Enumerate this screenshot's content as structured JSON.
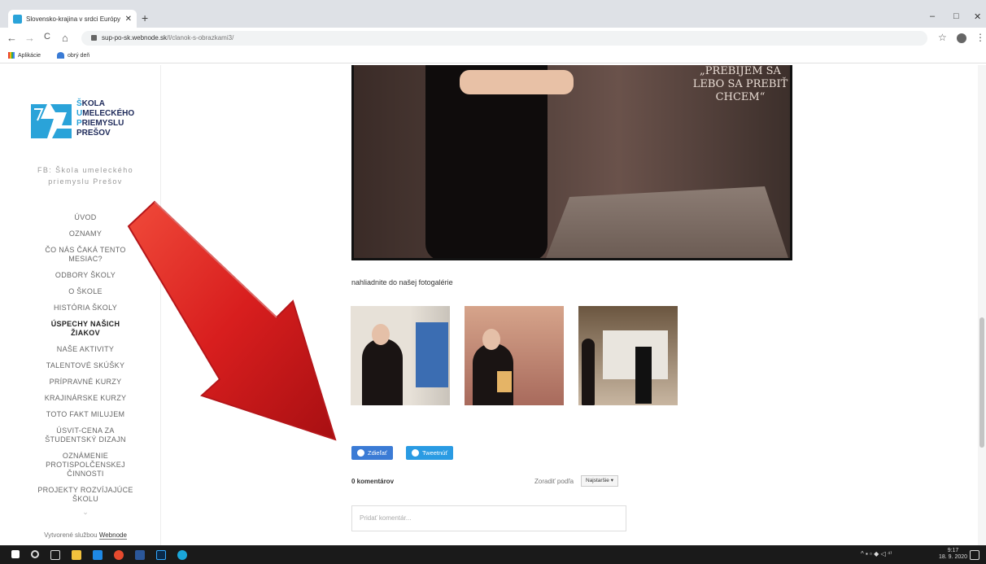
{
  "browser": {
    "tab_title": "Slovensko-krajina v srdci Európy",
    "tab_close": "✕",
    "new_tab": "+",
    "url_host": "sup-po-sk.webnode.sk",
    "url_path": "/l/clanok-s-obrazkami3/",
    "nav_back": "←",
    "nav_forward": "→",
    "nav_reload": "C",
    "nav_home": "⌂",
    "star": "☆",
    "menu": "⋮",
    "win_min": "–",
    "win_max": "□",
    "win_close": "✕",
    "bookmarks": [
      "Aplikácie",
      "obrý deň"
    ]
  },
  "site": {
    "logo_lines": [
      {
        "cap": "Š",
        "rest": "KOLA"
      },
      {
        "cap": "U",
        "rest": "MELECKÉHO"
      },
      {
        "cap": "P",
        "rest": "RIEMYSLU"
      },
      {
        "cap": "",
        "rest": "PREŠOV"
      }
    ],
    "fb_line1": "FB: Škola umeleckého",
    "fb_line2": "priemyslu Prešov",
    "menu": [
      {
        "label": "ÚVOD",
        "active": false
      },
      {
        "label": "OZNAMY",
        "active": false
      },
      {
        "label": "ČO NÁS ČAKÁ TENTO MESIAC?",
        "active": false
      },
      {
        "label": "ODBORY ŠKOLY",
        "active": false
      },
      {
        "label": "O ŠKOLE",
        "active": false
      },
      {
        "label": "HISTÓRIA ŠKOLY",
        "active": false
      },
      {
        "label": "ÚSPECHY NAŠICH ŽIAKOV",
        "active": true
      },
      {
        "label": "NAŠE AKTIVITY",
        "active": false
      },
      {
        "label": "TALENTOVÉ SKÚŠKY",
        "active": false
      },
      {
        "label": "PRÍPRAVNÉ KURZY",
        "active": false
      },
      {
        "label": "KRAJINÁRSKE KURZY",
        "active": false
      },
      {
        "label": "TOTO FAKT MILUJEM",
        "active": false
      },
      {
        "label": "ÚSVIT-CENA ZA ŠTUDENTSKÝ DIZAJN",
        "active": false
      },
      {
        "label": "OZNÁMENIE PROTISPOLČENSKEJ ČINNOSTI",
        "active": false
      },
      {
        "label": "PROJEKTY ROZVÍJAJÚCE ŠKOLU",
        "active": false
      }
    ],
    "menu_more": "⌄",
    "created_prefix": "Vytvorené službou",
    "created_brand": "Webnode"
  },
  "article": {
    "hero_sign": "„PREBIJEM SA LEBO SA PREBIŤ CHCEM“",
    "gallery_text": "nahliadnite do našej fotogalérie",
    "share_fb": "Zdieľať",
    "share_tw": "Tweetnúť",
    "comments_count": "0 komentárov",
    "sort_label": "Zoradiť podľa",
    "sort_value": "Najstaršie ▾",
    "comment_placeholder": "Pridať komentár..."
  },
  "taskbar": {
    "tray": "^ ▪ ▫ ◆ ◁ ⁴⁾",
    "time": "9:17",
    "date": "18. 9. 2020"
  },
  "colors": {
    "logo_blue": "#2aa3d9",
    "logo_dark": "#1e2a5a",
    "share_fb": "#3b7bd5",
    "share_tw": "#2a9be3",
    "arrow_red": "#d81e1e"
  }
}
